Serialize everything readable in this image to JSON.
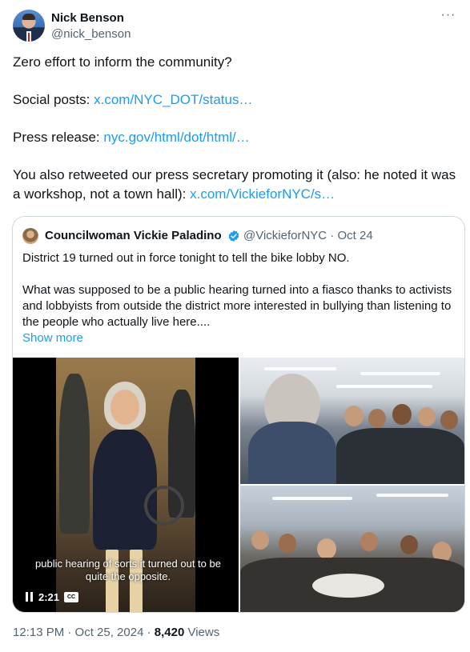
{
  "author": {
    "name": "Nick Benson",
    "handle": "@nick_benson",
    "more_icon": "more-dots-icon"
  },
  "tweet": {
    "line1": "Zero effort to inform the community?",
    "social_label": "Social posts: ",
    "social_link": "x.com/NYC_DOT/status…",
    "press_label": "Press release: ",
    "press_link": "nyc.gov/html/dot/html/…",
    "retweet_text": "You also retweeted our press secretary promoting it (also: he noted it was a workshop, not a town hall): ",
    "retweet_link": "x.com/VickieforNYC/s…"
  },
  "quote": {
    "name": "Councilwoman Vickie Paladino",
    "handle_date": "@VickieforNYC · Oct 24",
    "verified_icon": "verified-badge-icon",
    "para1": "District 19 turned out in force tonight to tell the bike lobby NO.",
    "para2": "What was supposed to be a public hearing turned into a fiasco thanks to activists and lobbyists from outside the district more interested in bullying than listening to the people who actually live here....",
    "show_more": "Show more",
    "video": {
      "subtitle": "public hearing of sorts it turned out to be quite the opposite.",
      "time": "2:21",
      "cc": "CC"
    }
  },
  "meta": {
    "time_date": "12:13 PM · Oct 25, 2024 · ",
    "views_count": "8,420",
    "views_label": " Views"
  },
  "colors": {
    "link": "#1d9bf0",
    "text": "#0f1419",
    "secondary": "#536471",
    "border": "#cfd9de"
  }
}
